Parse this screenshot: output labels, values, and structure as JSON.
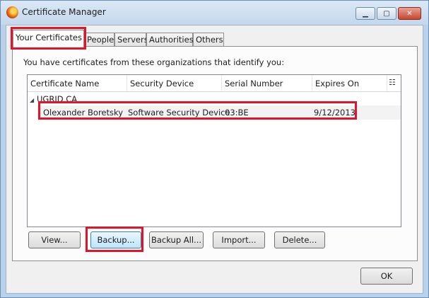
{
  "window": {
    "title": "Certificate Manager",
    "icon": "firefox-icon",
    "controls": {
      "minimize": "minimize-icon",
      "maximize": "maximize-icon",
      "close": "close-icon"
    }
  },
  "tabs": [
    {
      "label": "Your Certificates",
      "active": true
    },
    {
      "label": "People",
      "active": false
    },
    {
      "label": "Servers",
      "active": false
    },
    {
      "label": "Authorities",
      "active": false
    },
    {
      "label": "Others",
      "active": false
    }
  ],
  "intro_text": "You have certificates from these organizations that identify you:",
  "table": {
    "columns": [
      "Certificate Name",
      "Security Device",
      "Serial Number",
      "Expires On"
    ],
    "column_picker_icon": "column-picker-icon",
    "groups": [
      {
        "name": "UGRID CA",
        "expanded": true,
        "rows": [
          {
            "name": "Olexander Boretsky",
            "device": "Software Security Device",
            "serial": "03:BE",
            "expires": "9/12/2013"
          }
        ]
      }
    ]
  },
  "buttons": {
    "view": "View...",
    "backup": "Backup...",
    "backup_all": "Backup All...",
    "import": "Import...",
    "delete": "Delete...",
    "ok": "OK"
  },
  "colors": {
    "highlight": "#e0142a",
    "title_bar": "#c4d7ec",
    "focus_button": "#bee6fd"
  }
}
